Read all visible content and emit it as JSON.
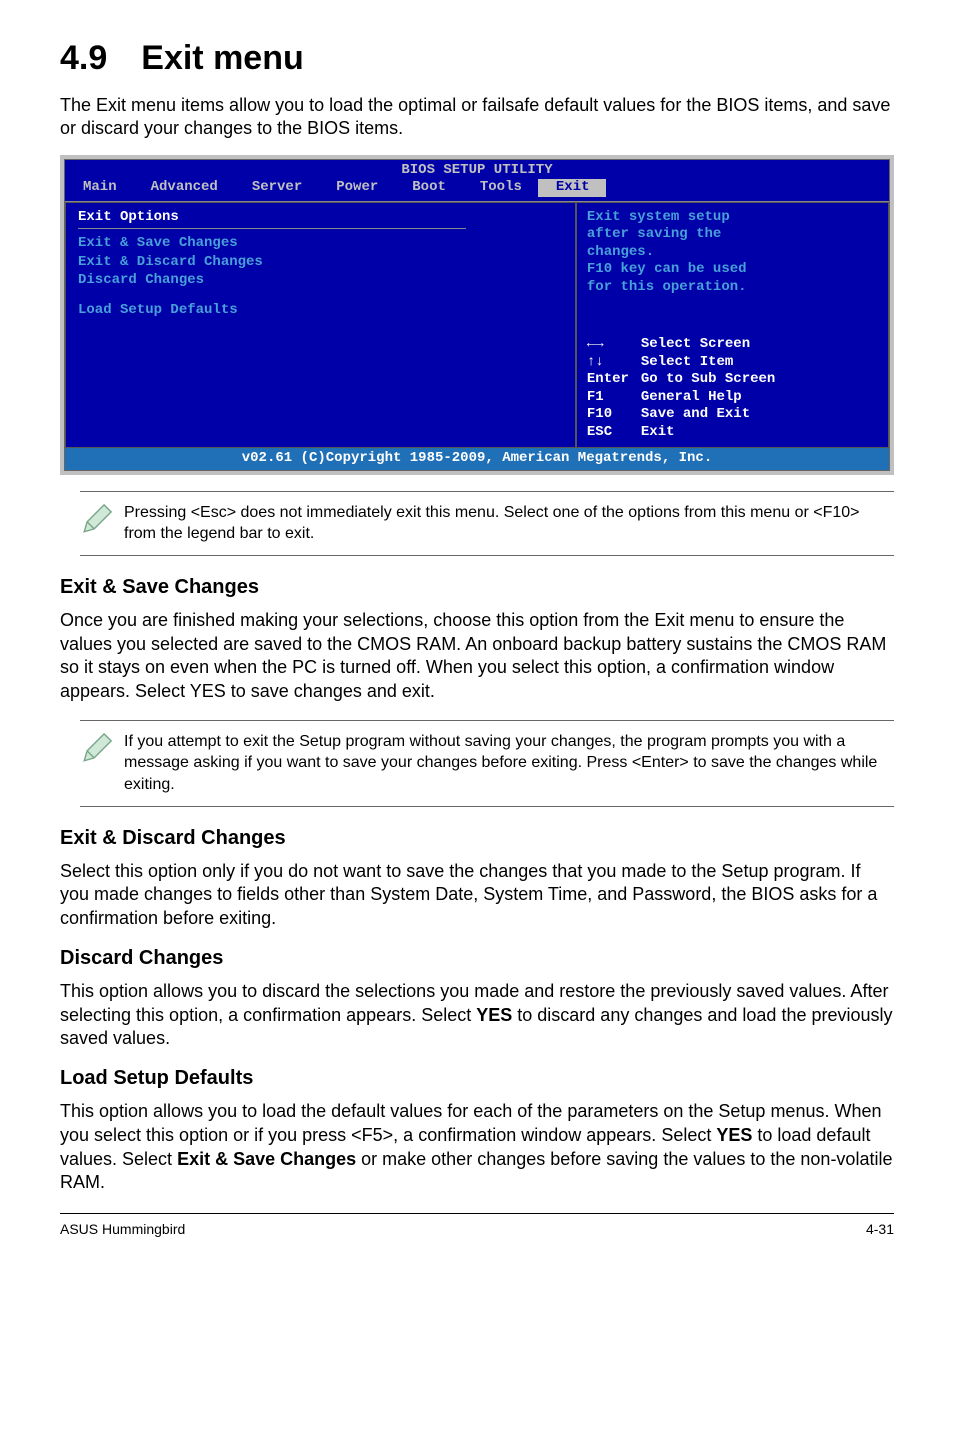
{
  "section": {
    "number": "4.9",
    "title": "Exit menu"
  },
  "lead": "The Exit menu items allow you to load the optimal or failsafe default values for the BIOS items, and save or discard your changes to the BIOS items.",
  "bios": {
    "title": "BIOS SETUP UTILITY",
    "tabs": [
      "Main",
      "Advanced",
      "Server",
      "Power",
      "Boot",
      "Tools",
      "Exit"
    ],
    "active_tab": "Exit",
    "left_header": "Exit Options",
    "options": [
      "Exit & Save Changes",
      "Exit & Discard Changes",
      "Discard Changes"
    ],
    "option_after_gap": "Load Setup Defaults",
    "help_lines": [
      "Exit system setup",
      "after saving the",
      "changes.",
      "",
      "F10 key can be used",
      "for this operation."
    ],
    "keys": [
      {
        "k": "←→",
        "d": "Select Screen"
      },
      {
        "k": "↑↓",
        "d": "Select Item"
      },
      {
        "k": "Enter",
        "d": "Go to Sub Screen"
      },
      {
        "k": "F1",
        "d": "General Help"
      },
      {
        "k": "F10",
        "d": "Save and Exit"
      },
      {
        "k": "ESC",
        "d": "Exit"
      }
    ],
    "footer": "v02.61 (C)Copyright 1985-2009, American Megatrends, Inc."
  },
  "note1": "Pressing <Esc> does not immediately exit this menu. Select one of the options from this menu or <F10> from the legend bar to exit.",
  "s1": {
    "h": "Exit & Save Changes",
    "p": "Once you are finished making your selections, choose this option from the Exit menu to ensure the values you selected are saved to the CMOS RAM. An onboard backup battery sustains the CMOS RAM so it stays on even when the PC is turned off. When you select this option, a confirmation window appears. Select YES to save changes and exit."
  },
  "note2": "If you attempt to exit the Setup program without saving your changes, the program prompts you with a message asking if you want to save your changes before exiting. Press <Enter> to save the changes while exiting.",
  "s2": {
    "h": "Exit & Discard Changes",
    "p": "Select this option only if you do not want to save the changes that you made to the Setup program. If you made changes to fields other than System Date, System Time, and Password, the BIOS asks for a confirmation before exiting."
  },
  "s3": {
    "h": "Discard Changes",
    "p1": "This option allows you to discard the selections you made and restore the previously saved values. After selecting this option, a confirmation appears. Select ",
    "bold": "YES",
    "p2": " to discard any changes and load the previously saved values."
  },
  "s4": {
    "h": "Load Setup Defaults",
    "p1": "This option allows you to load the default values for each of the parameters on the Setup menus. When you select this option or if you press <F5>, a confirmation window appears. Select ",
    "b1": "YES",
    "p2": " to load default values. Select ",
    "b2": "Exit & Save Changes",
    "p3": " or make other changes before saving the values to the non-volatile RAM."
  },
  "footer": {
    "left": "ASUS Hummingbird",
    "right": "4-31"
  }
}
